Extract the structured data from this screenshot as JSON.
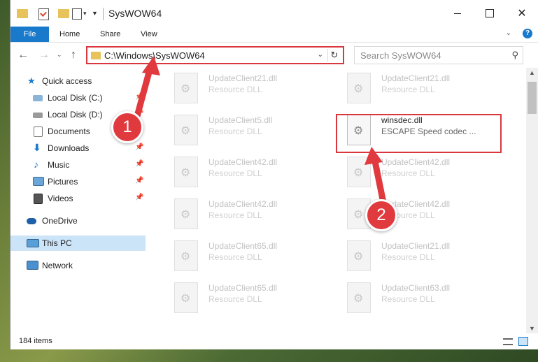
{
  "window": {
    "title": "SysWOW64"
  },
  "ribbon": {
    "tabs": [
      "File",
      "Home",
      "Share",
      "View"
    ]
  },
  "address": {
    "path": "C:\\Windows\\SysWOW64"
  },
  "search": {
    "placeholder": "Search SysWOW64"
  },
  "sidebar": {
    "items": [
      {
        "label": "Quick access",
        "icon": "star-icon"
      },
      {
        "label": "Local Disk (C:)",
        "icon": "drive-icon"
      },
      {
        "label": "Local Disk (D:)",
        "icon": "drive-icon"
      },
      {
        "label": "Documents",
        "icon": "documents-icon"
      },
      {
        "label": "Downloads",
        "icon": "download-icon"
      },
      {
        "label": "Music",
        "icon": "music-icon"
      },
      {
        "label": "Pictures",
        "icon": "pictures-icon"
      },
      {
        "label": "Videos",
        "icon": "videos-icon"
      },
      {
        "label": "OneDrive",
        "icon": "cloud-icon"
      },
      {
        "label": "This PC",
        "icon": "computer-icon"
      },
      {
        "label": "Network",
        "icon": "network-icon"
      }
    ]
  },
  "files": [
    {
      "name": "UpdateClient21.dll",
      "desc": "Resource DLL"
    },
    {
      "name": "UpdateClient21.dll",
      "desc": "Resource DLL"
    },
    {
      "name": "UpdateClient5.dll",
      "desc": "Resource DLL"
    },
    {
      "name": "winsdec.dll",
      "desc": "ESCAPE Speed codec ..."
    },
    {
      "name": "UpdateClient42.dll",
      "desc": "Resource DLL"
    },
    {
      "name": "UpdateClient42.dll",
      "desc": "Resource DLL"
    },
    {
      "name": "UpdateClient42.dll",
      "desc": "Resource DLL"
    },
    {
      "name": "UpdateClient42.dll",
      "desc": "Resource DLL"
    },
    {
      "name": "UpdateClient65.dll",
      "desc": "Resource DLL"
    },
    {
      "name": "UpdateClient21.dll",
      "desc": "Resource DLL"
    },
    {
      "name": "UpdateClient65.dll",
      "desc": "Resource DLL"
    },
    {
      "name": "UpdateClient63.dll",
      "desc": "Resource DLL"
    }
  ],
  "status": {
    "count": "184 items"
  },
  "callouts": [
    "1",
    "2"
  ],
  "colors": {
    "accent": "#1979ca",
    "highlight": "#d9373d"
  }
}
